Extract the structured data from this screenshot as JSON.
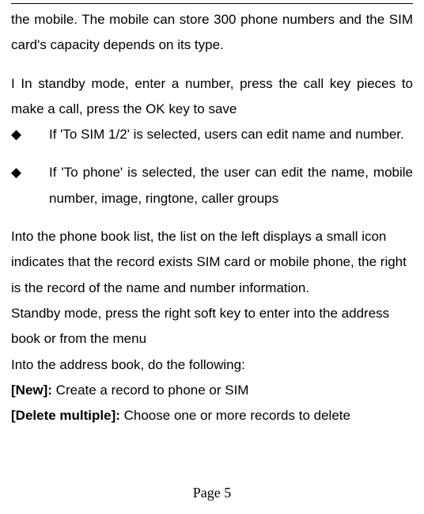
{
  "p1": "the mobile. The mobile can store 300 phone numbers and the SIM card's capacity depends on its type.",
  "p2": "I In standby mode, enter a number, press the call key pieces to make a call, press the OK key to save",
  "bullet_glyph": "◆",
  "b1": "If 'To SIM 1/2' is selected, users can edit name and number.",
  "b2": "If 'To phone' is selected, the user can edit the name, mobile number, image, ringtone, caller groups",
  "p3a": "Into the phone book list, the list on the left displays a small icon indicates that the record exists SIM card or mobile phone, the right is the record of the name and number information.",
  "p3b": "Standby mode, press the right soft key to enter into the address book or from the menu",
  "p3c": "Into the address book, do the following:",
  "new_label": "[New]: ",
  "new_text": "Create a record to phone or SIM",
  "del_label": "[Delete multiple]: ",
  "del_text": "Choose one or more records to delete",
  "pager": "Page 5"
}
